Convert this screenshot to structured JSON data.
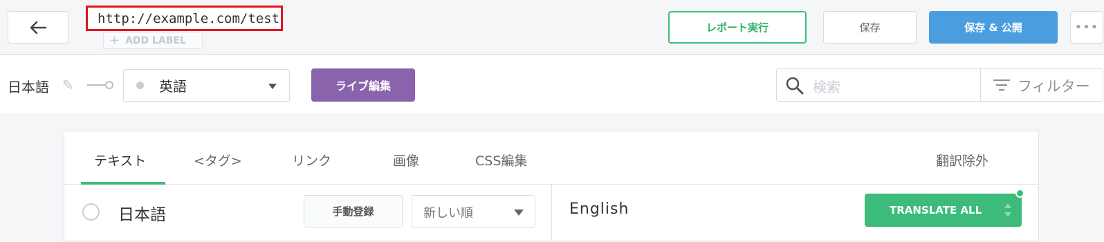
{
  "header": {
    "url": "http://example.com/test",
    "add_label": "ADD LABEL",
    "report_button": "レポート実行",
    "save_button": "保存",
    "publish_button": "保存 & 公開",
    "more_button": "•••"
  },
  "language_bar": {
    "source_language": "日本語",
    "target_language": "英語",
    "live_edit_button": "ライブ編集",
    "search_placeholder": "検索",
    "filter_label": "フィルター"
  },
  "tabs": [
    {
      "label": "テキスト",
      "active": true
    },
    {
      "label": "<タグ>",
      "active": false
    },
    {
      "label": "リンク",
      "active": false
    },
    {
      "label": "画像",
      "active": false
    },
    {
      "label": "CSS編集",
      "active": false
    },
    {
      "label": "翻訳除外",
      "active": false
    }
  ],
  "columns": {
    "source_header": "日本語",
    "manual_register_button": "手動登録",
    "sort_option": "新しい順",
    "target_header": "English",
    "translate_all_button": "TRANSLATE ALL"
  },
  "colors": {
    "accent_green": "#3dbb7a",
    "publish_blue": "#4a9edf",
    "live_edit_purple": "#8a63ad",
    "highlight_red": "#e0141e"
  }
}
